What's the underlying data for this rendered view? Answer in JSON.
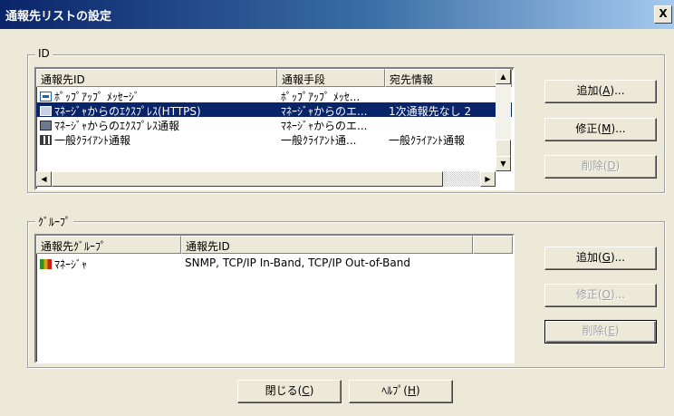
{
  "window": {
    "title": "通報先リストの設定",
    "close_label": "X"
  },
  "id_group": {
    "label": "ID",
    "columns": [
      "通報先ID",
      "通報手段",
      "宛先情報"
    ],
    "rows": [
      {
        "icon": "popup-message-icon",
        "id": "ﾎﾟｯﾌﾟｱｯﾌﾟ ﾒｯｾｰｼﾞ",
        "method": "ﾎﾟｯﾌﾟｱｯﾌﾟ ﾒｯｾ...",
        "dest": ""
      },
      {
        "icon": "express-https-icon",
        "id": "ﾏﾈｰｼﾞｬからのｴｸｽﾌﾟﾚｽ(HTTPS)",
        "method": "ﾏﾈｰｼﾞｬからのエ...",
        "dest": "1次通報先なし 2",
        "selected": true
      },
      {
        "icon": "express-report-icon",
        "id": "ﾏﾈｰｼﾞｬからのｴｸｽﾌﾟﾚｽ通報",
        "method": "ﾏﾈｰｼﾞｬからのエ...",
        "dest": ""
      },
      {
        "icon": "client-report-icon",
        "id": "一般ｸﾗｲｱﾝﾄ通報",
        "method": "一般ｸﾗｲｱﾝﾄ通...",
        "dest": "一般ｸﾗｲｱﾝﾄ通報"
      }
    ],
    "buttons": {
      "add": {
        "text": "追加(",
        "key": "A",
        "tail": ")..."
      },
      "edit": {
        "text": "修正(",
        "key": "M",
        "tail": ")..."
      },
      "delete": {
        "text": "削除(",
        "key": "D",
        "tail": ")"
      }
    }
  },
  "group_group": {
    "label": "ｸﾞﾙｰﾌﾟ",
    "columns": [
      "通報先ｸﾞﾙｰﾌﾟ",
      "通報先ID",
      ""
    ],
    "rows": [
      {
        "icon": "manager-group-icon",
        "group": "ﾏﾈｰｼﾞｬ",
        "ids": "SNMP, TCP/IP In-Band, TCP/IP Out-of-Band"
      }
    ],
    "buttons": {
      "add": {
        "text": "追加(",
        "key": "G",
        "tail": ")..."
      },
      "edit": {
        "text": "修正(",
        "key": "O",
        "tail": ")..."
      },
      "delete": {
        "text": "削除(",
        "key": "E",
        "tail": ")"
      }
    }
  },
  "footer": {
    "close": {
      "text": "閉じる(",
      "key": "C",
      "tail": ")"
    },
    "help": {
      "text": "ﾍﾙﾌﾟ(",
      "key": "H",
      "tail": ")"
    }
  }
}
